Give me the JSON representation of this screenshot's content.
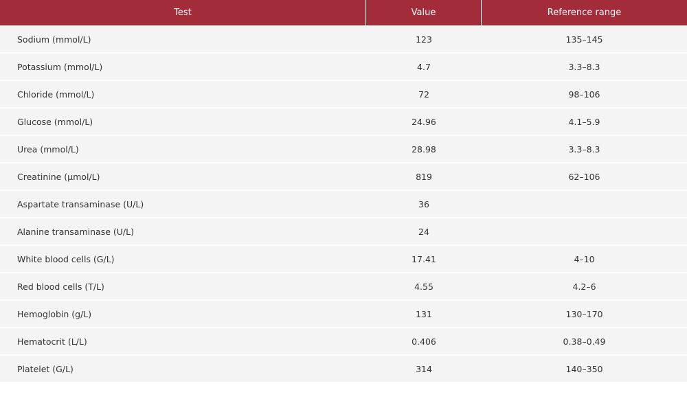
{
  "table": {
    "headers": [
      "Test",
      "Value",
      "Reference range"
    ],
    "rows": [
      {
        "test": "Sodium (mmol/L)",
        "value": "123",
        "reference": "135–145"
      },
      {
        "test": "Potassium (mmol/L)",
        "value": "4.7",
        "reference": "3.3–8.3"
      },
      {
        "test": "Chloride (mmol/L)",
        "value": "72",
        "reference": "98–106"
      },
      {
        "test": "Glucose (mmol/L)",
        "value": "24.96",
        "reference": "4.1–5.9"
      },
      {
        "test": "Urea (mmol/L)",
        "value": "28.98",
        "reference": "3.3–8.3"
      },
      {
        "test": "Creatinine (µmol/L)",
        "value": "819",
        "reference": "62–106"
      },
      {
        "test": "Aspartate transaminase (U/L)",
        "value": "36",
        "reference": ""
      },
      {
        "test": "Alanine transaminase (U/L)",
        "value": "24",
        "reference": ""
      },
      {
        "test": "White blood cells (G/L)",
        "value": "17.41",
        "reference": "4–10"
      },
      {
        "test": "Red blood cells (T/L)",
        "value": "4.55",
        "reference": "4.2–6"
      },
      {
        "test": "Hemoglobin (g/L)",
        "value": "131",
        "reference": "130–170"
      },
      {
        "test": "Hematocrit (L/L)",
        "value": "0.406",
        "reference": "0.38–0.49"
      },
      {
        "test": "Platelet (G/L)",
        "value": "314",
        "reference": "140–350"
      }
    ]
  },
  "colors": {
    "header_background": "#a22c3a",
    "header_text": "#ffffff",
    "row_background": "#f4f4f4",
    "body_text": "#333333"
  }
}
